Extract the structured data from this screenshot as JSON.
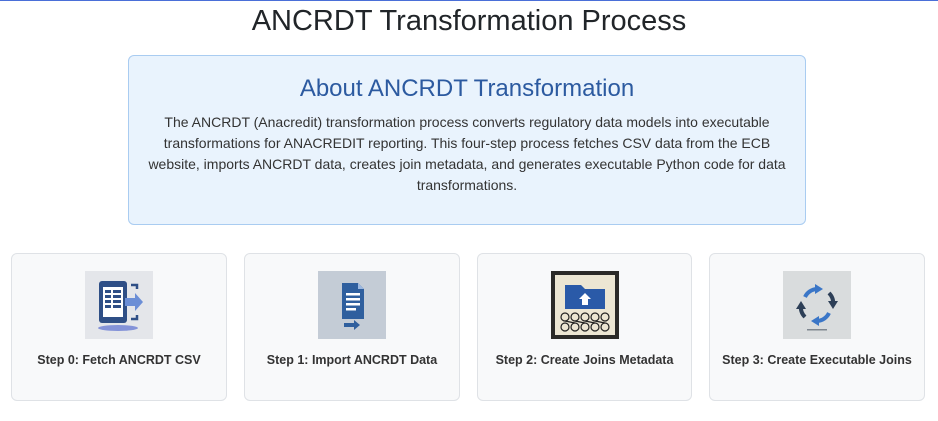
{
  "page": {
    "title": "ANCRDT Transformation Process"
  },
  "about": {
    "heading": "About ANCRDT Transformation",
    "description": "The ANCRDT (Anacredit) transformation process converts regulatory data models into executable transformations for ANACREDIT reporting. This four-step process fetches CSV data from the ECB website, imports ANCRDT data, creates join metadata, and generates executable Python code for data transformations."
  },
  "steps": [
    {
      "label": "Step 0: Fetch ANCRDT CSV",
      "icon": "fetch-csv-icon"
    },
    {
      "label": "Step 1: Import ANCRDT Data",
      "icon": "import-document-icon"
    },
    {
      "label": "Step 2: Create Joins Metadata",
      "icon": "joins-metadata-icon"
    },
    {
      "label": "Step 3: Create Executable Joins",
      "icon": "refresh-cycle-icon"
    }
  ],
  "colors": {
    "accent": "#2c5aa0",
    "panel": "#e9f3fd",
    "card": "#f8f9fa"
  }
}
